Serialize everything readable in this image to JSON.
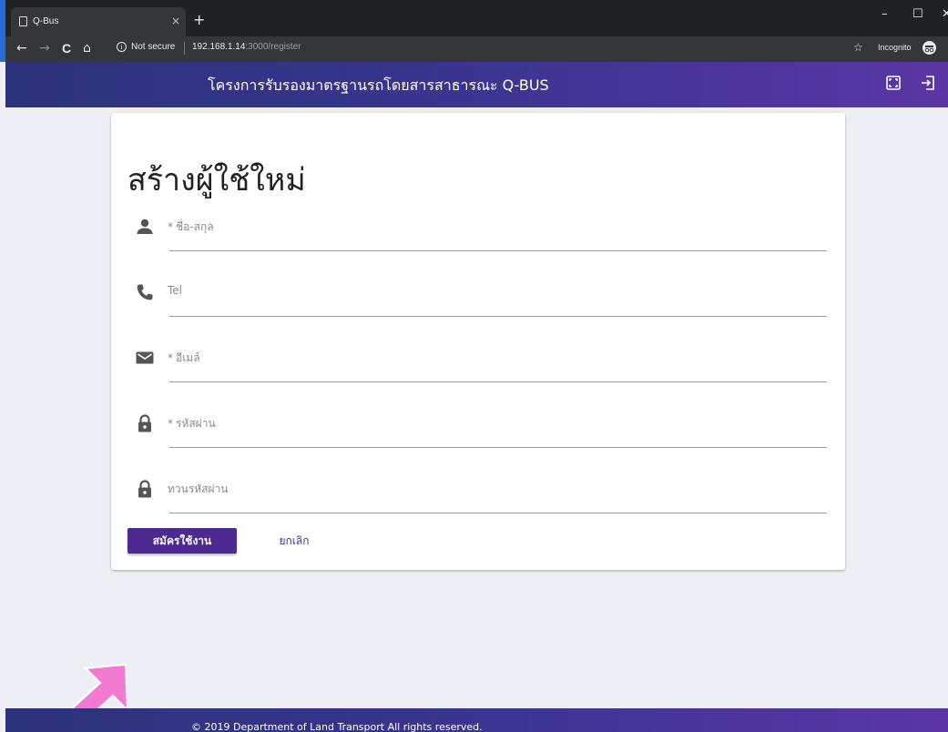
{
  "browser": {
    "tab_title": "Q-Bus",
    "tab_close": "×",
    "new_tab": "+",
    "window_controls": {
      "minimize": "–",
      "maximize": "☐",
      "close": "✕"
    },
    "nav": {
      "back": "←",
      "forward": "→",
      "reload": "C",
      "home": "⌂"
    },
    "security_text": "Not secure",
    "url_host": "192.168.1.14",
    "url_path": ":3000/register",
    "star": "☆",
    "incognito_label": "Incognito",
    "menu": "⋮"
  },
  "header": {
    "title": "โครงการรับรองมาตรฐานรถโดยสารสาธารณะ Q-BUS",
    "icons": [
      "fullscreen-icon",
      "logout-icon"
    ]
  },
  "form": {
    "title": "สร้างผู้ใช้ใหม่",
    "required_mark": "*",
    "fields": [
      {
        "icon": "person-icon",
        "label": "ชื่อ-สกุล",
        "required": true
      },
      {
        "icon": "phone-icon",
        "label": "Tel",
        "required": false
      },
      {
        "icon": "mail-icon",
        "label": "อีเมล์",
        "required": true
      },
      {
        "icon": "lock-icon",
        "label": "รหัสผ่าน",
        "required": true
      },
      {
        "icon": "lock-icon",
        "label": "ทวนรหัสผ่าน",
        "required": false
      }
    ],
    "submit_label": "สมัครใช้งาน",
    "cancel_label": "ยกเลิก"
  },
  "footer": {
    "text": "© 2019 Department of Land Transport All rights reserved."
  },
  "colors": {
    "header_start": "#2c3279",
    "header_end": "#5a36a5",
    "primary_button": "#4c2a91",
    "annotation_arrow": "#f37ad1"
  }
}
